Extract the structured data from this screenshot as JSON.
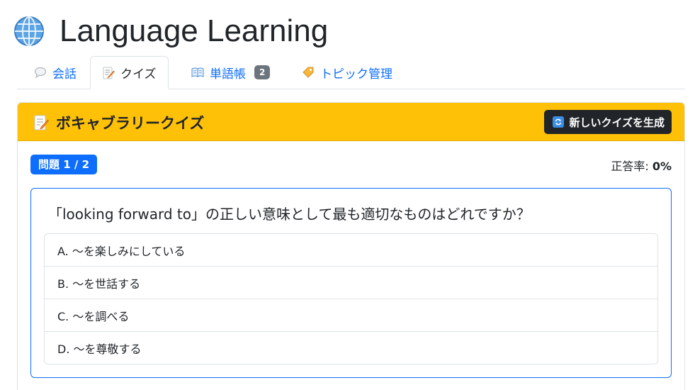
{
  "app": {
    "title": "Language Learning",
    "logo_icon": "globe-icon"
  },
  "tabs": [
    {
      "label": "会話",
      "icon": "speech-bubble-icon",
      "active": false
    },
    {
      "label": "クイズ",
      "icon": "memo-icon",
      "active": true
    },
    {
      "label": "単語帳",
      "icon": "open-book-icon",
      "active": false,
      "badge": "2"
    },
    {
      "label": "トピック管理",
      "icon": "tag-icon",
      "active": false
    }
  ],
  "quiz": {
    "title": "ボキャブラリークイズ",
    "title_icon": "memo-icon",
    "generate_button": "新しいクイズを生成",
    "generate_icon": "refresh-icon",
    "progress_label": "問題 1 / 2",
    "accuracy_label": "正答率:",
    "accuracy_value": "0%",
    "question": "「looking forward to」の正しい意味として最も適切なものはどれですか？",
    "options": [
      "A. 〜を楽しみにしている",
      "B. 〜を世話する",
      "C. 〜を調べる",
      "D. 〜を尊敬する"
    ]
  },
  "colors": {
    "accent": "#0d6efd",
    "header_bg": "#ffc107",
    "button_dark": "#212529",
    "badge_gray": "#6c757d"
  }
}
